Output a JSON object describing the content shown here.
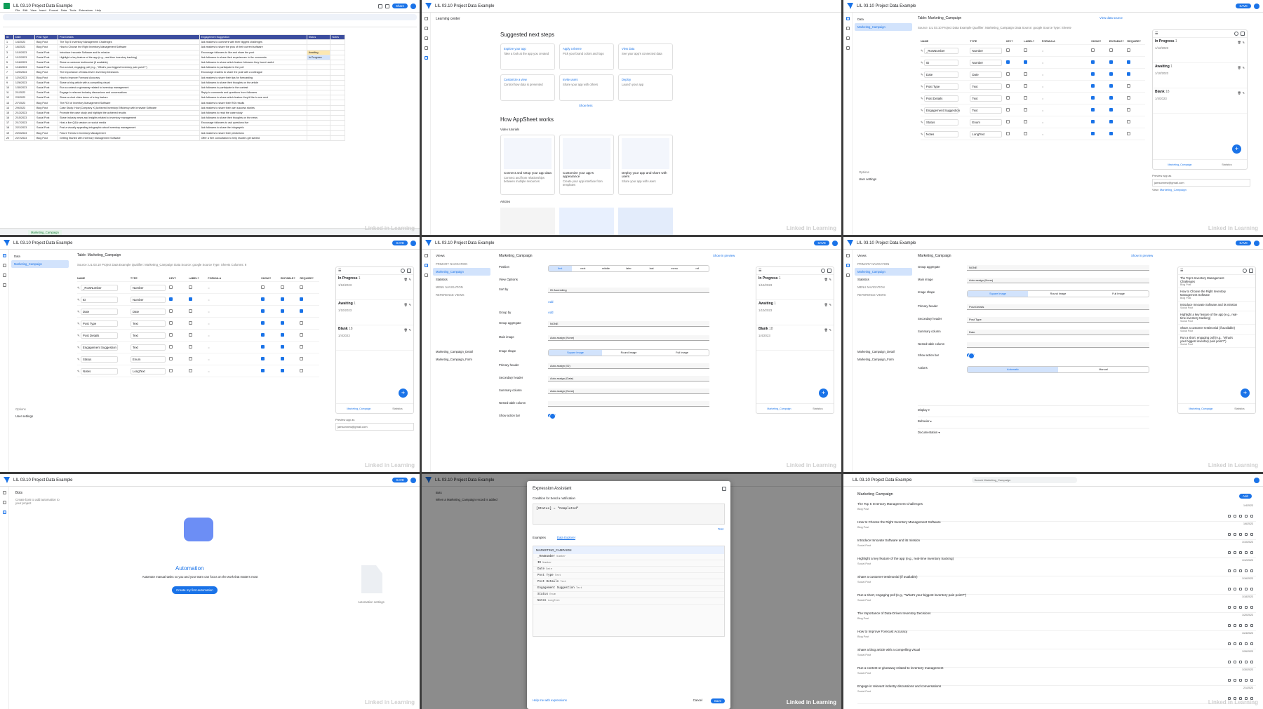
{
  "app_title": "LIL 03.10 Project Data Example",
  "watermark": "Linked in Learning",
  "sheet": {
    "menu": [
      "File",
      "Edit",
      "View",
      "Insert",
      "Format",
      "Data",
      "Tools",
      "Extensions",
      "Help"
    ],
    "tab_name": "Marketing_Campaign",
    "share": "Share",
    "headers": [
      "ID",
      "Date",
      "Post Type",
      "Post Details",
      "Engagement Suggestion",
      "Status",
      "Notes"
    ],
    "rows": [
      [
        "1",
        "1/4/2023",
        "Blog Post",
        "The Top 5 Inventory Management Challenges",
        "Ask readers to comment with their biggest challenges",
        "",
        ""
      ],
      [
        "2",
        "1/6/2023",
        "Blog Post",
        "How to Choose the Right Inventory Management Software",
        "Ask readers to share the pros of their current software",
        "",
        ""
      ],
      [
        "3",
        "1/10/2023",
        "Social Post",
        "Introduce Innovate Software and its mission",
        "Encourage followers to like and share the post",
        "Awaiting",
        ""
      ],
      [
        "4",
        "1/12/2023",
        "Social Post",
        "Highlight a key feature of the app (e.g., real-time inventory tracking)",
        "Ask followers to share their experiences in the comments",
        "In Progress",
        ""
      ],
      [
        "5",
        "1/16/2023",
        "Social Post",
        "Share a customer testimonial (if available)",
        "Ask followers to share which feature followers they found useful",
        "",
        ""
      ],
      [
        "6",
        "1/18/2023",
        "Social Post",
        "Run a short, engaging poll (e.g., \"What's your biggest inventory pain point?\")",
        "Ask followers to participate in the poll",
        "",
        ""
      ],
      [
        "7",
        "1/20/2023",
        "Blog Post",
        "The Importance of Data-Driven Inventory Decisions",
        "Encourage readers to share the post with a colleague",
        "",
        ""
      ],
      [
        "8",
        "1/24/2023",
        "Blog Post",
        "How to Improve Forecast Accuracy",
        "Ask readers to share their tips for forecasting",
        "",
        ""
      ],
      [
        "9",
        "1/26/2023",
        "Social Post",
        "Share a blog article with a compelling visual",
        "Ask followers to share their thoughts on the article",
        "",
        ""
      ],
      [
        "10",
        "1/30/2023",
        "Social Post",
        "Run a contest or giveaway related to inventory management",
        "Ask followers to participate in the contest",
        "",
        ""
      ],
      [
        "11",
        "2/1/2023",
        "Social Post",
        "Engage in relevant industry discussions and conversations",
        "Reply to comments and questions from followers",
        "",
        ""
      ],
      [
        "12",
        "2/3/2023",
        "Social Post",
        "Share a short video demo of a key feature",
        "Ask followers to share which feature they'd like to see next",
        "",
        ""
      ],
      [
        "13",
        "2/7/2023",
        "Blog Post",
        "The ROI of Inventory Management Software",
        "Ask readers to share their ROI results",
        "",
        ""
      ],
      [
        "14",
        "2/9/2023",
        "Blog Post",
        "Case Study: How [Company X] Achieved Inventory Efficiency with Innovate Software",
        "Ask readers to share their own success stories",
        "",
        ""
      ],
      [
        "15",
        "2/13/2023",
        "Social Post",
        "Promote the case study and highlight the achieved results",
        "Ask followers to read the case study",
        "",
        ""
      ],
      [
        "16",
        "2/15/2023",
        "Social Post",
        "Share industry news and insights related to inventory management",
        "Ask followers to share their thoughts on the news",
        "",
        ""
      ],
      [
        "17",
        "2/17/2023",
        "Social Post",
        "Host a live Q&A session on social media",
        "Encourage followers to ask questions live",
        "",
        ""
      ],
      [
        "18",
        "2/21/2023",
        "Social Post",
        "Post a visually appealing infographic about inventory management",
        "Ask followers to share the infographic",
        "",
        ""
      ],
      [
        "19",
        "2/23/2023",
        "Blog Post",
        "Future Trends in Inventory Management",
        "Ask readers to share their predictions",
        "",
        ""
      ],
      [
        "20",
        "2/27/2023",
        "Blog Post",
        "Getting Started with Inventory Management Software",
        "Offer a free consultation to help readers get started",
        "",
        ""
      ]
    ]
  },
  "learning": {
    "header": "Learning center",
    "suggested_title": "Suggested next steps",
    "cards": [
      {
        "title": "Explore your app",
        "desc": "Take a look at the app you created"
      },
      {
        "title": "Apply a theme",
        "desc": "Pick your brand colors and logo"
      },
      {
        "title": "View data",
        "desc": "See your app's connected data"
      },
      {
        "title": "Customize a view",
        "desc": "Control how data is presented"
      },
      {
        "title": "Invite users",
        "desc": "Share your app with others"
      },
      {
        "title": "Deploy",
        "desc": "Launch your app"
      }
    ],
    "show_less": "Show less",
    "how_title": "How AppSheet works",
    "video_label": "Video tutorials",
    "videos": [
      {
        "title": "Connect and setup your app data",
        "desc": "Connect and from relationships between multiple resources"
      },
      {
        "title": "Customize your app's appearance",
        "desc": "Create your app interface from templates"
      },
      {
        "title": "Deploy your app and share with users",
        "desc": "Share your app with users"
      }
    ],
    "articles_label": "Articles"
  },
  "preview": {
    "groups": [
      {
        "label": "In Progress",
        "count": "1",
        "date": "1/12/2023"
      },
      {
        "label": "Awaiting",
        "count": "1",
        "date": "1/10/2023"
      },
      {
        "label": "Blank",
        "count": "18",
        "date": "1/4/2023"
      }
    ],
    "footer_tabs": [
      "Marketing_Campaign",
      "Statistics"
    ],
    "preview_as": "Preview app as",
    "email": "jamsonnew@gmail.com",
    "apply": "Apply",
    "view_label": "View:",
    "view_value": "Marketing_Campaign",
    "table_label": "Table:",
    "table_value": "Marketing_Campaign",
    "edit": "Edit"
  },
  "data": {
    "section": "Data",
    "table_title": "Table: Marketing_Campaign",
    "meta": "Source: LIL 03.10 Project Data Example   Qualifier: Marketing_Campaign   Data Source: google   Source Type: Sheets   Columns: 8",
    "view_source": "View data source",
    "col_headers": [
      "NAME",
      "TYPE",
      "KEY?",
      "LABEL?",
      "FORMULA",
      "SHOW?",
      "EDITABLE?",
      "REQUIRE?"
    ],
    "columns": [
      {
        "name": "_RowNumber",
        "type": "Number",
        "key": false,
        "label": false,
        "show": false,
        "edit": false,
        "req": false
      },
      {
        "name": "ID",
        "type": "Number",
        "key": true,
        "label": true,
        "show": true,
        "edit": true,
        "req": true
      },
      {
        "name": "Date",
        "type": "Date",
        "key": false,
        "label": false,
        "show": true,
        "edit": true,
        "req": true
      },
      {
        "name": "Post Type",
        "type": "Text",
        "key": false,
        "label": false,
        "show": true,
        "edit": true,
        "req": false
      },
      {
        "name": "Post Details",
        "type": "Text",
        "key": false,
        "label": false,
        "show": true,
        "edit": true,
        "req": false
      },
      {
        "name": "Engagement Suggestion",
        "type": "Text",
        "key": false,
        "label": false,
        "show": true,
        "edit": true,
        "req": false
      },
      {
        "name": "Status",
        "type": "Enum",
        "key": false,
        "label": false,
        "show": true,
        "edit": true,
        "req": false
      },
      {
        "name": "Notes",
        "type": "LongText",
        "key": false,
        "label": false,
        "show": true,
        "edit": true,
        "req": false
      }
    ],
    "tree_item": "Marketing_Campaign",
    "options": "Options",
    "user_settings": "User settings"
  },
  "views": {
    "section": "Views",
    "title": "Marketing_Campaign",
    "show_in_preview": "Show in preview",
    "primary_nav": "PRIMARY NAVIGATION",
    "menu_nav": "MENU NAVIGATION",
    "reference_views": "REFERENCE VIEWS",
    "nav_items": [
      "Marketing_Campaign",
      "Statistics"
    ],
    "system_items": [
      "Marketing_Campaign_Detail",
      "Marketing_Campaign_Form"
    ],
    "position": "Position",
    "positions": [
      "first",
      "next",
      "middle",
      "later",
      "last",
      "menu",
      "ref"
    ],
    "view_options": "View Options",
    "sort_by": "Sort by",
    "sort_col": "ID",
    "sort_dir": "Ascending",
    "add": "Add",
    "group_by": "Group by",
    "group_aggregate": "Group aggregate",
    "agg_value": "NONE",
    "main_image": "Main image",
    "auto_none": "Auto assign (None)",
    "image_shape": "Image shape",
    "shapes": [
      "Square Image",
      "Round Image",
      "Full Image"
    ],
    "primary_header": "Primary header",
    "primary_val": "Auto assign (ID)",
    "secondary_header": "Secondary header",
    "secondary_val": "Auto assign (Date)",
    "summary_column": "Summary column",
    "summary_val": "Auto assign (None)",
    "nested_table": "Nested table column",
    "show_action_bar": "Show action bar",
    "post_details": "Post Details",
    "post_type": "Post Type",
    "date": "Date",
    "actions": "Actions",
    "actions_opts": [
      "Automatic",
      "Manual"
    ],
    "display": "Display",
    "behavior": "Behavior",
    "documentation": "Documentation"
  },
  "bots": {
    "section": "Bots",
    "hint": "Create bots to add automation to your project",
    "title": "Automation",
    "desc": "Automate manual tasks so you and your team can focus on the work that matters most",
    "create": "Create my first automation",
    "settings": "Automation settings"
  },
  "expr": {
    "title": "Expression Assistant",
    "condition": "Condition for Send a notification",
    "expression": "[Status] = \"Completed\"",
    "tab_examples": "Examples",
    "tab_explorer": "Data Explorer",
    "test": "Test",
    "table": "MARKETING_CAMPAIGN",
    "fields": [
      {
        "n": "_RowNumber",
        "t": "Number"
      },
      {
        "n": "ID",
        "t": "Number"
      },
      {
        "n": "Date",
        "t": "Date"
      },
      {
        "n": "Post Type",
        "t": "Text"
      },
      {
        "n": "Post Details",
        "t": "Text"
      },
      {
        "n": "Engagement Suggestion",
        "t": "Text"
      },
      {
        "n": "Status",
        "t": "Enum"
      },
      {
        "n": "Notes",
        "t": "LongText"
      }
    ],
    "help": "Help me with expressions",
    "cancel": "Cancel",
    "save": "Save",
    "when": "When a Marketing_Campaign record is added"
  },
  "app": {
    "title": "Marketing Campaign",
    "search": "Search Marketing_Campaign",
    "add": "Add",
    "items": [
      {
        "t": "The Top 5 Inventory Management Challenges",
        "s": "Blog Post",
        "d": "1/4/2023"
      },
      {
        "t": "How to Choose the Right Inventory Management Software",
        "s": "Blog Post",
        "d": "1/6/2023"
      },
      {
        "t": "Introduce Innovate Software and its mission",
        "s": "Social Post",
        "d": "1/10/2023"
      },
      {
        "t": "Highlight a key feature of the app (e.g., real-time inventory tracking)",
        "s": "Social Post",
        "d": "1/12/2023"
      },
      {
        "t": "Share a customer testimonial (if available)",
        "s": "Social Post",
        "d": "1/16/2023"
      },
      {
        "t": "Run a short, engaging poll (e.g., \"What's your biggest inventory pain point?\")",
        "s": "Social Post",
        "d": "1/18/2023"
      },
      {
        "t": "The Importance of Data-Driven Inventory Decisions",
        "s": "Blog Post",
        "d": "1/20/2023"
      },
      {
        "t": "How to Improve Forecast Accuracy",
        "s": "Blog Post",
        "d": "1/24/2023"
      },
      {
        "t": "Share a blog article with a compelling visual",
        "s": "Social Post",
        "d": "1/26/2023"
      },
      {
        "t": "Run a contest or giveaway related to inventory management",
        "s": "Social Post",
        "d": "1/30/2023"
      },
      {
        "t": "Engage in relevant industry discussions and conversations",
        "s": "Social Post",
        "d": "2/1/2023"
      }
    ]
  },
  "colors": {
    "accent": "#1a73e8",
    "sheet_header": "#3c4d9e"
  }
}
